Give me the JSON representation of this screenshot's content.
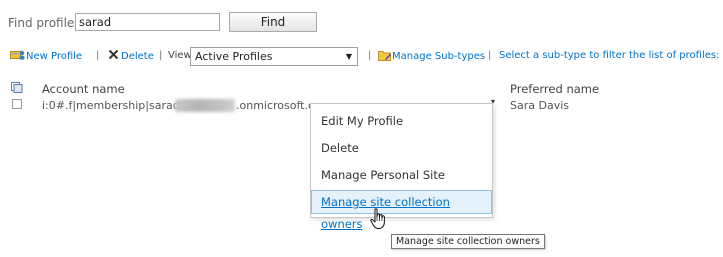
{
  "search": {
    "label": "Find profiles",
    "value": "sarad",
    "button_label": "Find"
  },
  "toolbar": {
    "new_profile": "New Profile",
    "sep1": "|",
    "delete": "Delete",
    "sep2": "|",
    "view_label": "View:",
    "view_selected": "Active Profiles",
    "sep3": "|",
    "manage_subtypes": "Manage Sub-types",
    "sep4": "|",
    "subtype_hint": "Select a sub-type to filter the list of profiles:"
  },
  "list": {
    "columns": [
      "Account name",
      "Preferred name"
    ],
    "rows": [
      {
        "account_prefix": "i:0#.f|membership|sarad@",
        "account_suffix": ".onmicrosoft.com",
        "preferred_name": "Sara Davis"
      }
    ]
  },
  "context_menu": {
    "items": [
      "Edit My Profile",
      "Delete",
      "Manage Personal Site",
      "Manage site collection owners"
    ]
  },
  "tooltip": "Manage site collection owners",
  "colors": {
    "link": "#0072c6",
    "hover_bg": "#e5f1fb",
    "hover_border": "#92c0e0"
  },
  "icons": {
    "new_profile": "user-add-icon",
    "delete": "x-icon",
    "manage_subtypes": "folder-edit-icon",
    "list_header": "documents-icon",
    "cursor": "hand-pointer-icon"
  }
}
